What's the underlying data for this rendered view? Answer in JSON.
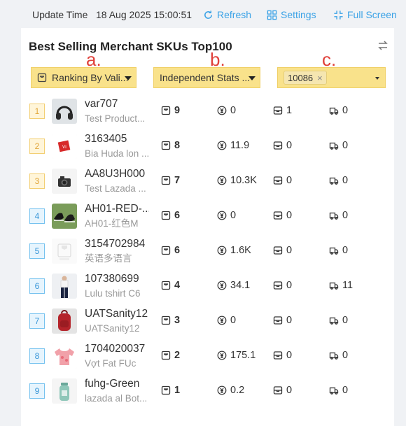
{
  "topbar": {
    "update_label": "Update Time",
    "update_time": "18 Aug 2025 15:00:51",
    "refresh_label": "Refresh",
    "settings_label": "Settings",
    "fullscreen_label": "Full Screen",
    "link_color": "#3aa2e6"
  },
  "card": {
    "title": "Best Selling Merchant SKUs Top100",
    "annotations": {
      "a": "a.",
      "b": "b.",
      "c": "c."
    },
    "filters": {
      "ranking": {
        "value": "Ranking By Vali..."
      },
      "stats": {
        "value": "Independent Stats ..."
      },
      "store": {
        "tag": "10086"
      }
    }
  },
  "colors": {
    "highlight": "#f9e28b",
    "annotation": "#e0403a",
    "rank_top": "#e1a53a",
    "rank_norm": "#3a97d8"
  },
  "rows": [
    {
      "rank": "1",
      "rank_style": "top",
      "sku": "var707",
      "name": "Test Product...",
      "orders": "9",
      "amount": "0",
      "stock": "1",
      "ship": "0",
      "thumb": "headphones"
    },
    {
      "rank": "2",
      "rank_style": "top",
      "sku": "3163405",
      "name": "Bia Huda lon ...",
      "orders": "8",
      "amount": "11.9",
      "stock": "0",
      "ship": "0",
      "thumb": "red-box"
    },
    {
      "rank": "3",
      "rank_style": "top",
      "sku": "AA8U3H000",
      "name": "Test Lazada ...",
      "orders": "7",
      "amount": "10.3K",
      "stock": "0",
      "ship": "0",
      "thumb": "camera"
    },
    {
      "rank": "4",
      "rank_style": "norm",
      "sku": "AH01-RED-...",
      "name": "AH01-红色M",
      "orders": "6",
      "amount": "0",
      "stock": "0",
      "ship": "0",
      "thumb": "shoes"
    },
    {
      "rank": "5",
      "rank_style": "norm",
      "sku": "3154702984",
      "name": "英语多语言",
      "orders": "6",
      "amount": "1.6K",
      "stock": "0",
      "ship": "0",
      "thumb": "placeholder"
    },
    {
      "rank": "6",
      "rank_style": "norm",
      "sku": "107380699",
      "name": "Lulu tshirt C6",
      "orders": "4",
      "amount": "34.1",
      "stock": "0",
      "ship": "11",
      "thumb": "person"
    },
    {
      "rank": "7",
      "rank_style": "norm",
      "sku": "UATSanity12",
      "name": "UATSanity12",
      "orders": "3",
      "amount": "0",
      "stock": "0",
      "ship": "0",
      "thumb": "backpack"
    },
    {
      "rank": "8",
      "rank_style": "norm",
      "sku": "1704020037",
      "name": "Vợt Fat FUc",
      "orders": "2",
      "amount": "175.1",
      "stock": "0",
      "ship": "0",
      "thumb": "tshirt"
    },
    {
      "rank": "9",
      "rank_style": "norm",
      "sku": "fuhg-Green",
      "name": "lazada al Bot...",
      "orders": "1",
      "amount": "0.2",
      "stock": "0",
      "ship": "0",
      "thumb": "bottle"
    }
  ]
}
